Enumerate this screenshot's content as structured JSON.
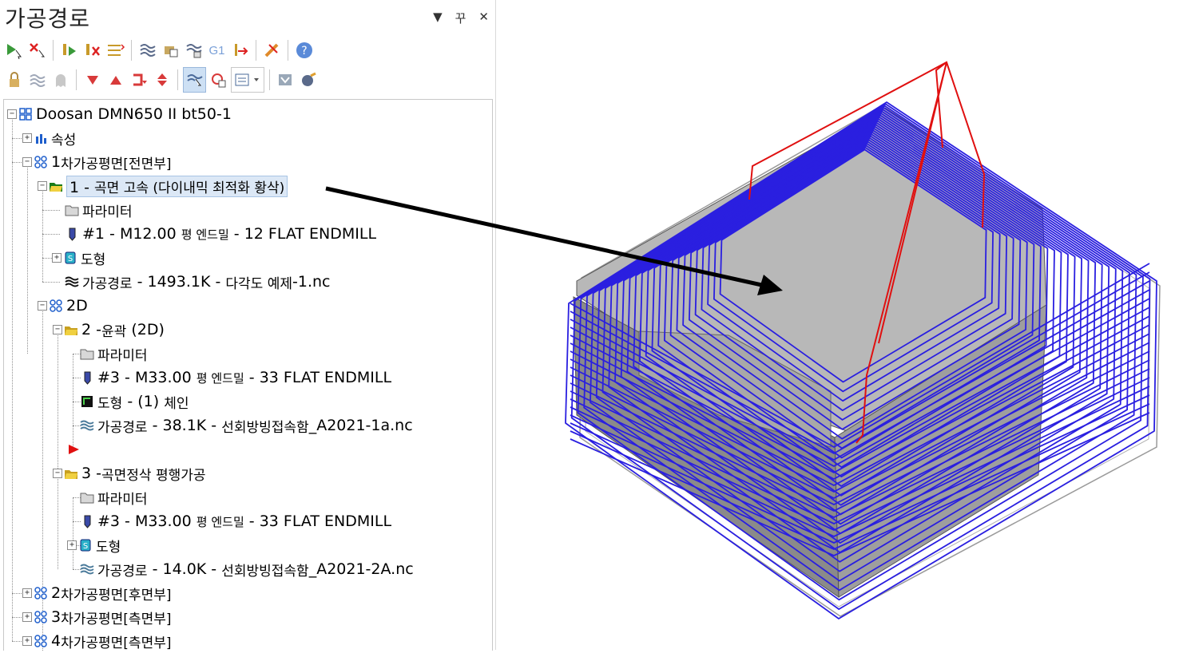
{
  "panel": {
    "title": "가공경로"
  },
  "tree": {
    "machine": "Doosan DMN650 II bt50-1",
    "properties": "속성",
    "group1": {
      "prefix": "1",
      "label": "차가공평면[전면부]"
    },
    "op1": {
      "num": "1 - ",
      "label": "곡면 고속 (다이내믹 최적화 황삭)"
    },
    "op1_param": "파라미터",
    "op1_tool": {
      "pre": "#1 - M12.00",
      "mid": "평 엔드밀",
      "post": "- 12 FLAT ENDMILL"
    },
    "op1_geom": "도형",
    "op1_path": {
      "label": "가공경로",
      "mid": "- 1493.1K -",
      "file_ko": "다각도 예제",
      "file": "-1.nc"
    },
    "group2d": "2D",
    "op2": {
      "num": "2 - ",
      "label": "윤곽",
      "post": "(2D)"
    },
    "op2_param": "파라미터",
    "op2_tool": {
      "pre": "#3 - M33.00",
      "mid": "평 엔드밀",
      "post": "- 33 FLAT ENDMILL"
    },
    "op2_geom": {
      "label": "도형",
      "mid": "- (1)",
      "post": "체인"
    },
    "op2_path": {
      "label": "가공경로",
      "mid": "- 38.1K -",
      "file_ko": "선회방빙접속함",
      "file": "_A2021-1a.nc"
    },
    "op3": {
      "num": "3 - ",
      "label": "곡면정삭 평행가공"
    },
    "op3_param": "파라미터",
    "op3_tool": {
      "pre": "#3 - M33.00",
      "mid": "평 엔드밀",
      "post": "- 33 FLAT ENDMILL"
    },
    "op3_geom": "도형",
    "op3_path": {
      "label": "가공경로",
      "mid": "- 14.0K -",
      "file_ko": "선회방빙접속함",
      "file": "_A2021-2A.nc"
    },
    "group2": {
      "prefix": "2",
      "label": "차가공평면[후면부]"
    },
    "group3": {
      "prefix": "3",
      "label": "차가공평면[측면부]"
    },
    "group4": {
      "prefix": "4",
      "label": "차가공평면[측면부]"
    }
  },
  "icons": {
    "toolbar_row1": [
      "select-all-ops-icon",
      "deselect-ops-icon",
      "regen-all-icon",
      "regen-dirty-icon",
      "move-ops-icon",
      "backplot-icon",
      "verify-icon",
      "simulate-icon",
      "g1-icon",
      "post-icon",
      "highfeed-icon",
      "help-icon"
    ],
    "toolbar_row2": [
      "lock-icon",
      "toolpath-display-icon",
      "ghost-icon",
      "move-down-icon",
      "move-up-icon",
      "insert-arrow-icon",
      "scroll-icon",
      "filter-icon",
      "display-selected-icon",
      "options-dropdown-icon",
      "sheet-icon",
      "tool-manager-icon"
    ]
  },
  "colors": {
    "toolpath": "#2a1fe0",
    "rapid": "#e01010",
    "stock": "#8c8c8c",
    "tree_icon_blue": "#1f5fcc"
  }
}
